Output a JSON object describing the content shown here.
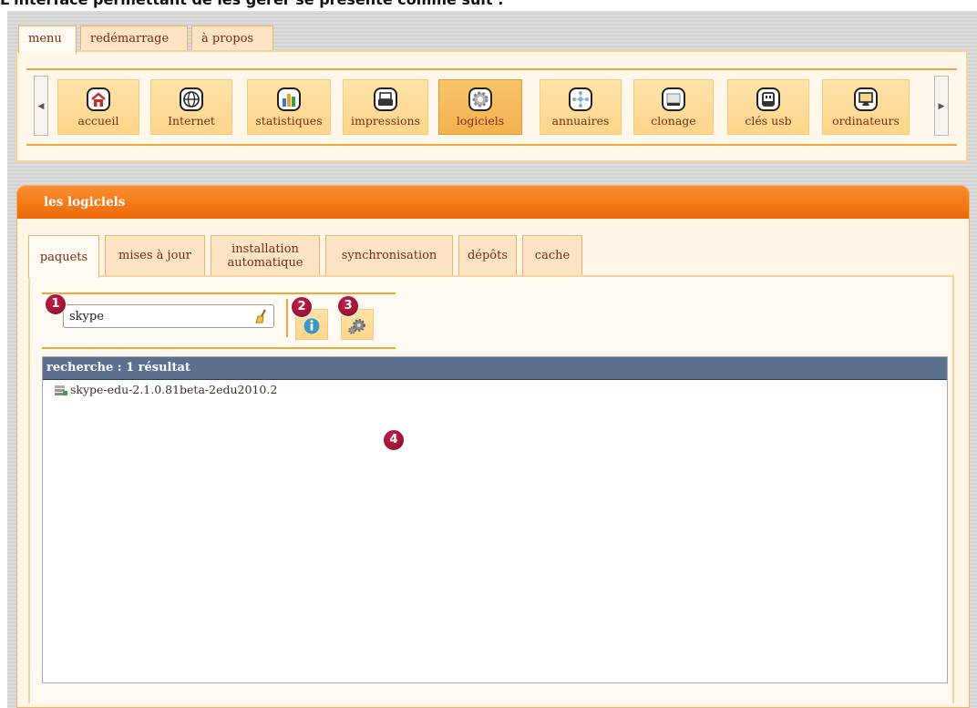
{
  "intro": "L'interface permettant de les gérer se présente comme suit :",
  "menu_tabs": [
    {
      "label": "menu"
    },
    {
      "label": "redémarrage"
    },
    {
      "label": "à propos"
    }
  ],
  "toolbar": {
    "scroll_left_icon": "triangle-left-icon",
    "scroll_right_icon": "triangle-right-icon",
    "items": [
      {
        "label": "accueil",
        "icon": "home-icon"
      },
      {
        "label": "Internet",
        "icon": "globe-icon"
      },
      {
        "label": "statistiques",
        "icon": "bar-chart-icon"
      },
      {
        "label": "impressions",
        "icon": "printer-icon"
      },
      {
        "label": "logiciels",
        "icon": "gear-icon"
      },
      {
        "label": "annuaires",
        "icon": "network-icon"
      },
      {
        "label": "clonage",
        "icon": "clone-disk-icon"
      },
      {
        "label": "clés usb",
        "icon": "usb-key-icon"
      },
      {
        "label": "ordinateurs",
        "icon": "monitor-icon"
      }
    ]
  },
  "panel": {
    "title": "les logiciels",
    "tabs": [
      {
        "label": "paquets"
      },
      {
        "label": "mises à jour"
      },
      {
        "label": "installation automatique"
      },
      {
        "label": "synchronisation"
      },
      {
        "label": "dépôts"
      },
      {
        "label": "cache"
      }
    ],
    "search": {
      "value": "skype",
      "clear_icon": "broom-icon"
    },
    "buttons": [
      {
        "icon": "info-icon"
      },
      {
        "icon": "gears-icon"
      }
    ],
    "badges": [
      "1",
      "2",
      "3",
      "4"
    ],
    "results": {
      "header": "recherche : 1 résultat",
      "rows": [
        {
          "name": "skype-edu-2.1.0.81beta-2edu2010.2",
          "icon": "package-icon"
        }
      ]
    }
  },
  "colors": {
    "accent": "#f3a53a",
    "header_orange": "#ee6a08",
    "tab_bg": "#fde5c4",
    "results_header": "#5b6f8f",
    "badge": "#8a0c28"
  }
}
